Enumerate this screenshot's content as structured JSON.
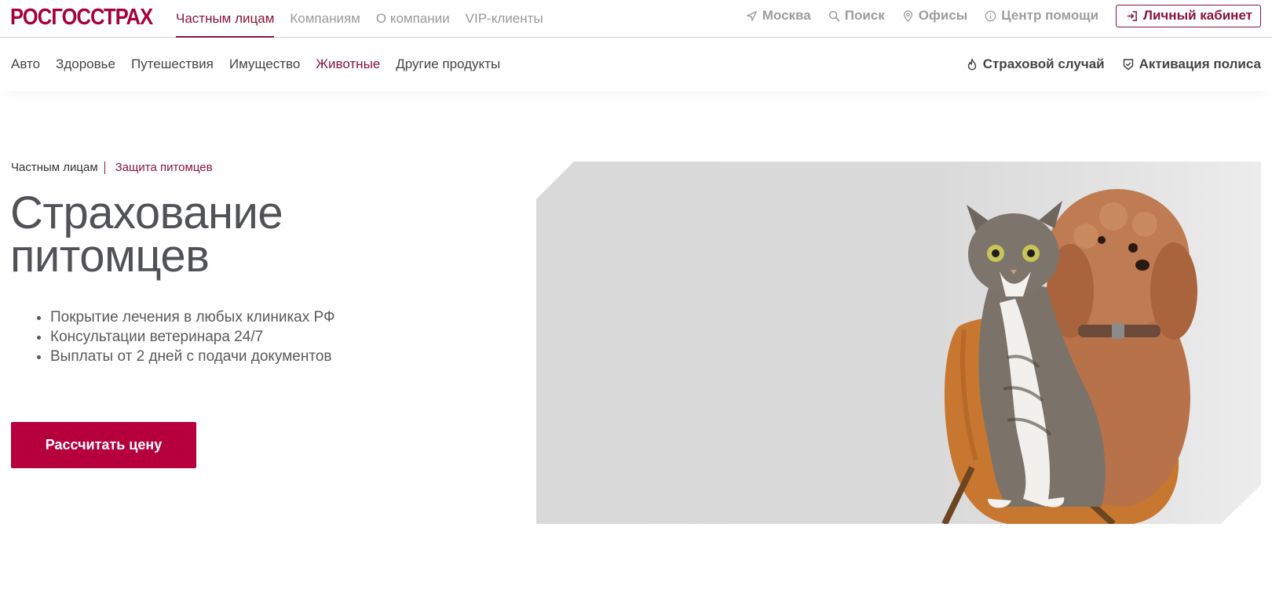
{
  "brand": {
    "logo_text": "РОСГОССТРАХ",
    "accent": "#8a1538",
    "cta_color": "#b6003d"
  },
  "topnav": {
    "items": [
      {
        "label": "Частным лицам",
        "active": true
      },
      {
        "label": "Компаниям"
      },
      {
        "label": "О компании"
      },
      {
        "label": "VIP-клиенты"
      }
    ]
  },
  "utility": {
    "city": "Москва",
    "search": "Поиск",
    "offices": "Офисы",
    "help": "Центр помощи",
    "cabinet": "Личный кабинет"
  },
  "categories": {
    "items": [
      {
        "label": "Авто"
      },
      {
        "label": "Здоровье"
      },
      {
        "label": "Путешествия"
      },
      {
        "label": "Имущество"
      },
      {
        "label": "Животные",
        "active": true
      },
      {
        "label": "Другие продукты"
      }
    ],
    "claim": "Страховой случай",
    "activate": "Активация полиса"
  },
  "breadcrumb": {
    "parent": "Частным лицам",
    "current": "Защита питомцев"
  },
  "hero": {
    "title_line1": "Страхование",
    "title_line2": "питомцев",
    "benefits": [
      "Покрытие лечения в любых клиниках РФ",
      "Консультации ветеринара 24/7",
      "Выплаты от 2 дней с подачи документов"
    ],
    "cta": "Рассчитать цену",
    "image": "cat-and-dog-on-orange-chair"
  }
}
